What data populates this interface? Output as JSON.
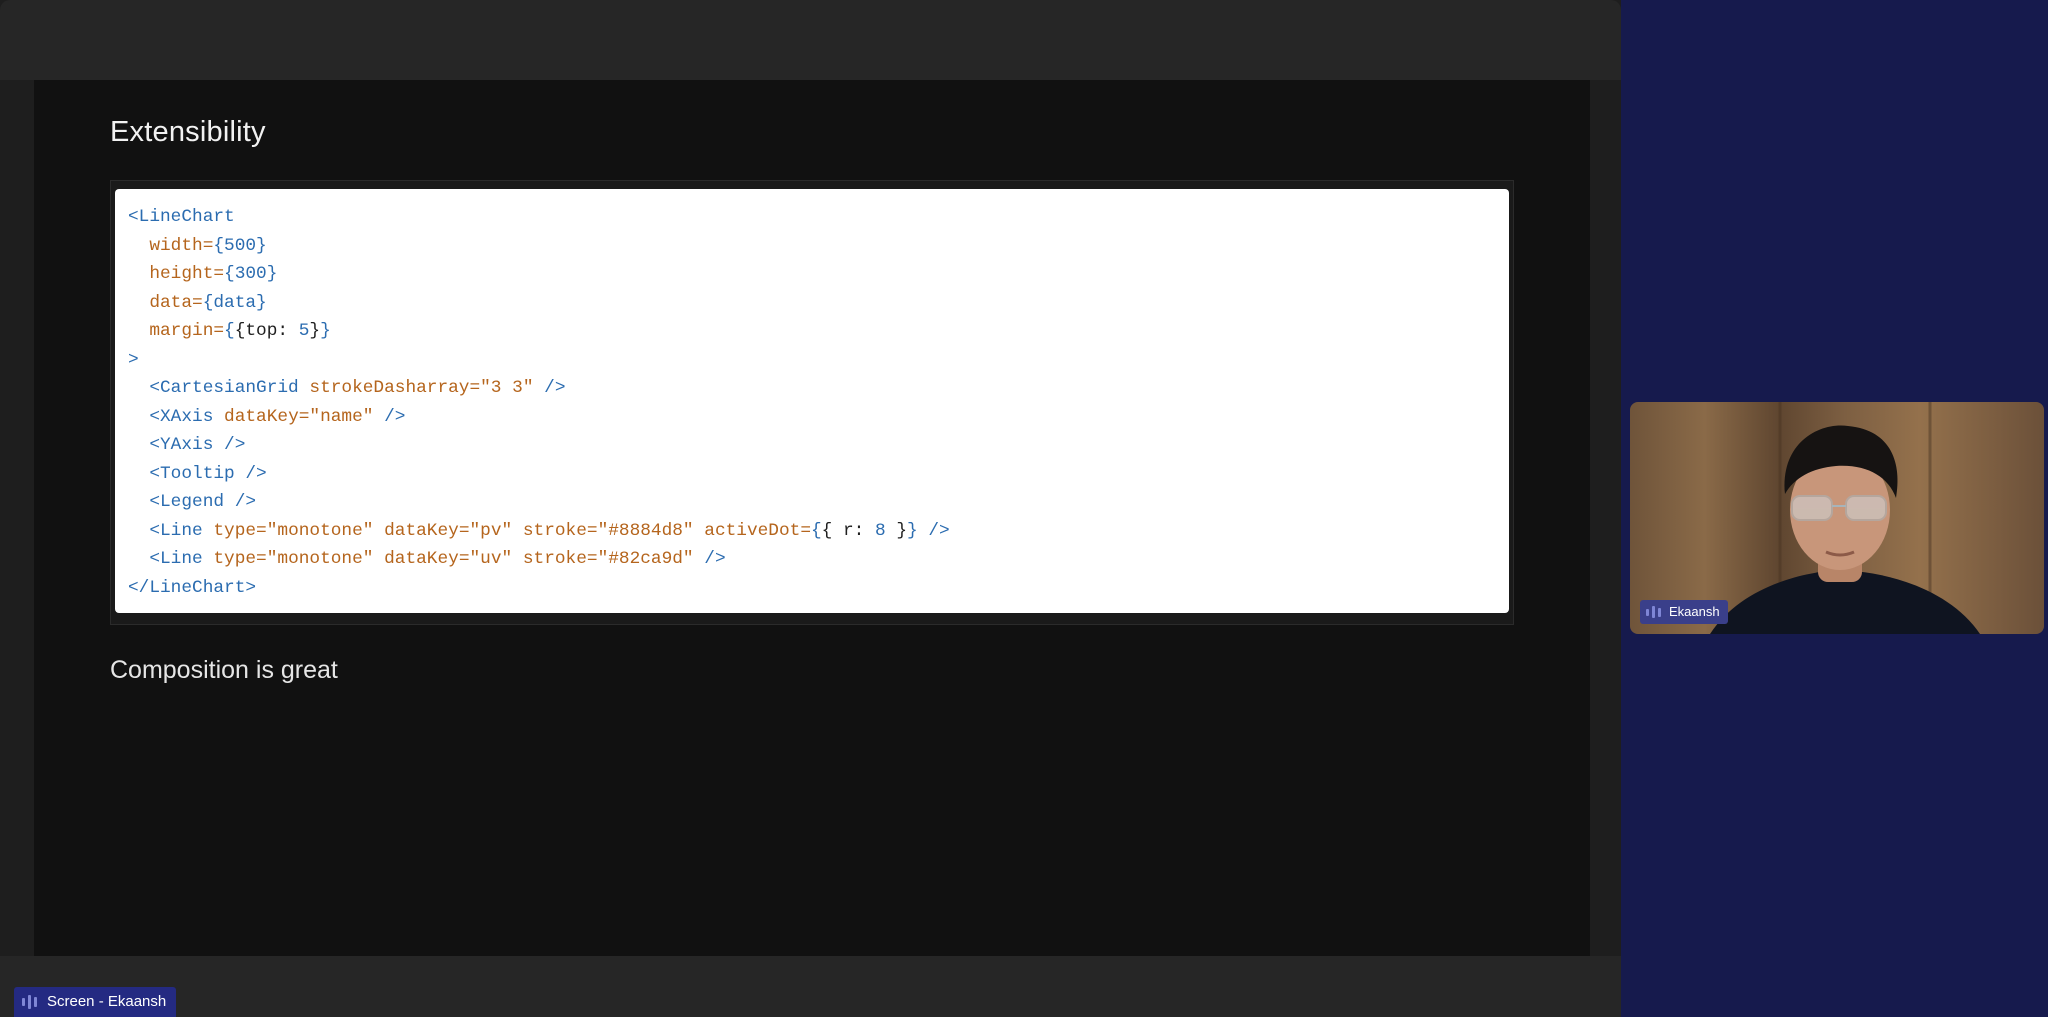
{
  "slide": {
    "title": "Extensibility",
    "caption": "Composition is great",
    "code_lines": [
      [
        {
          "t": "tag",
          "v": "<LineChart"
        }
      ],
      [
        {
          "t": "plain",
          "v": "  "
        },
        {
          "t": "attr",
          "v": "width="
        },
        {
          "t": "num",
          "v": "{500}"
        }
      ],
      [
        {
          "t": "plain",
          "v": "  "
        },
        {
          "t": "attr",
          "v": "height="
        },
        {
          "t": "num",
          "v": "{300}"
        }
      ],
      [
        {
          "t": "plain",
          "v": "  "
        },
        {
          "t": "attr",
          "v": "data="
        },
        {
          "t": "tag",
          "v": "{data}"
        }
      ],
      [
        {
          "t": "plain",
          "v": "  "
        },
        {
          "t": "attr",
          "v": "margin="
        },
        {
          "t": "tag",
          "v": "{"
        },
        {
          "t": "plain",
          "v": "{top: "
        },
        {
          "t": "num",
          "v": "5"
        },
        {
          "t": "plain",
          "v": "}"
        },
        {
          "t": "tag",
          "v": "}"
        }
      ],
      [
        {
          "t": "tag",
          "v": ">"
        }
      ],
      [
        {
          "t": "plain",
          "v": "  "
        },
        {
          "t": "tag",
          "v": "<CartesianGrid "
        },
        {
          "t": "attr",
          "v": "strokeDasharray="
        },
        {
          "t": "str",
          "v": "\"3 3\""
        },
        {
          "t": "tag",
          "v": " />"
        }
      ],
      [
        {
          "t": "plain",
          "v": "  "
        },
        {
          "t": "tag",
          "v": "<XAxis "
        },
        {
          "t": "attr",
          "v": "dataKey="
        },
        {
          "t": "str",
          "v": "\"name\""
        },
        {
          "t": "tag",
          "v": " />"
        }
      ],
      [
        {
          "t": "plain",
          "v": "  "
        },
        {
          "t": "tag",
          "v": "<YAxis />"
        }
      ],
      [
        {
          "t": "plain",
          "v": "  "
        },
        {
          "t": "tag",
          "v": "<Tooltip />"
        }
      ],
      [
        {
          "t": "plain",
          "v": "  "
        },
        {
          "t": "tag",
          "v": "<Legend />"
        }
      ],
      [
        {
          "t": "plain",
          "v": "  "
        },
        {
          "t": "tag",
          "v": "<Line "
        },
        {
          "t": "attr",
          "v": "type="
        },
        {
          "t": "str",
          "v": "\"monotone\""
        },
        {
          "t": "attr",
          "v": " dataKey="
        },
        {
          "t": "str",
          "v": "\"pv\""
        },
        {
          "t": "attr",
          "v": " stroke="
        },
        {
          "t": "str",
          "v": "\"#8884d8\""
        },
        {
          "t": "attr",
          "v": " activeDot="
        },
        {
          "t": "tag",
          "v": "{"
        },
        {
          "t": "plain",
          "v": "{ r: "
        },
        {
          "t": "num",
          "v": "8"
        },
        {
          "t": "plain",
          "v": " }"
        },
        {
          "t": "tag",
          "v": "}"
        },
        {
          "t": "tag",
          "v": " />"
        }
      ],
      [
        {
          "t": "plain",
          "v": "  "
        },
        {
          "t": "tag",
          "v": "<Line "
        },
        {
          "t": "attr",
          "v": "type="
        },
        {
          "t": "str",
          "v": "\"monotone\""
        },
        {
          "t": "attr",
          "v": " dataKey="
        },
        {
          "t": "str",
          "v": "\"uv\""
        },
        {
          "t": "attr",
          "v": " stroke="
        },
        {
          "t": "str",
          "v": "\"#82ca9d\""
        },
        {
          "t": "tag",
          "v": " />"
        }
      ],
      [
        {
          "t": "tag",
          "v": "</LineChart>"
        }
      ]
    ]
  },
  "screen_label": {
    "text": "Screen - Ekaansh",
    "icon": "audio-bars-icon"
  },
  "participant": {
    "name": "Ekaansh",
    "icon": "audio-bars-icon"
  },
  "colors": {
    "page_background": "#161a4d",
    "label_background": "#242a82",
    "code_tag": "#2b6cb0",
    "code_attr": "#b5651d"
  }
}
